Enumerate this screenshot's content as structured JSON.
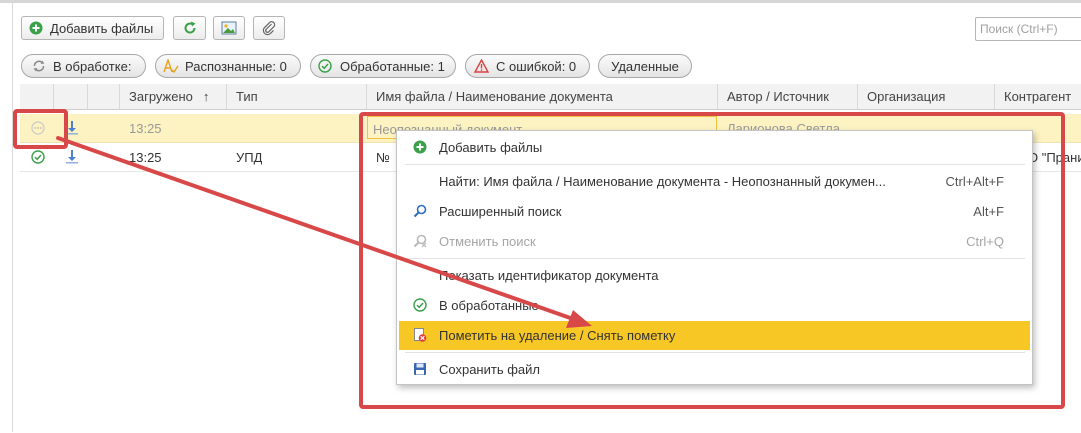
{
  "toolbar": {
    "add_files_label": "Добавить файлы",
    "refresh_icon": "refresh-icon",
    "image_icon": "image-icon",
    "attach_icon": "paperclip-icon"
  },
  "search": {
    "placeholder": "Поиск (Ctrl+F)"
  },
  "filters": {
    "processing": "В обработке:",
    "recognized": "Распознанные: 0",
    "processed": "Обработанные: 1",
    "errors": "С ошибкой: 0",
    "deleted": "Удаленные"
  },
  "table": {
    "columns": {
      "loaded": "Загружено",
      "sort_arrow": "↑",
      "type": "Тип",
      "filename": "Имя файла / Наименование документа",
      "author": "Автор / Источник",
      "organization": "Организация",
      "counterparty": "Контрагент"
    },
    "rows": [
      {
        "time": "13:25",
        "type": "",
        "name": "Неопознанный документ",
        "author": "Ларионова Светла",
        "org": "",
        "counterparty": ""
      },
      {
        "time": "13:25",
        "type": "УПД",
        "name": "№",
        "author": "",
        "org": "",
        "counterparty": "О \"Прани"
      }
    ]
  },
  "context_menu": {
    "items": [
      {
        "label": "Добавить файлы",
        "shortcut": ""
      },
      {
        "label": "Найти: Имя файла / Наименование документа - Неопознанный докумен...",
        "shortcut": "Ctrl+Alt+F"
      },
      {
        "label": "Расширенный поиск",
        "shortcut": "Alt+F"
      },
      {
        "label": "Отменить поиск",
        "shortcut": "Ctrl+Q"
      },
      {
        "label": "Показать идентификатор документа",
        "shortcut": ""
      },
      {
        "label": "В обработанные",
        "shortcut": ""
      },
      {
        "label": "Пометить на удаление / Снять пометку",
        "shortcut": ""
      },
      {
        "label": "Сохранить файл",
        "shortcut": ""
      }
    ]
  },
  "colors": {
    "accent_yellow": "#f7c825",
    "selected_row": "#fdf2c2",
    "annotation_red": "#d94848",
    "green": "#3aa14a"
  }
}
